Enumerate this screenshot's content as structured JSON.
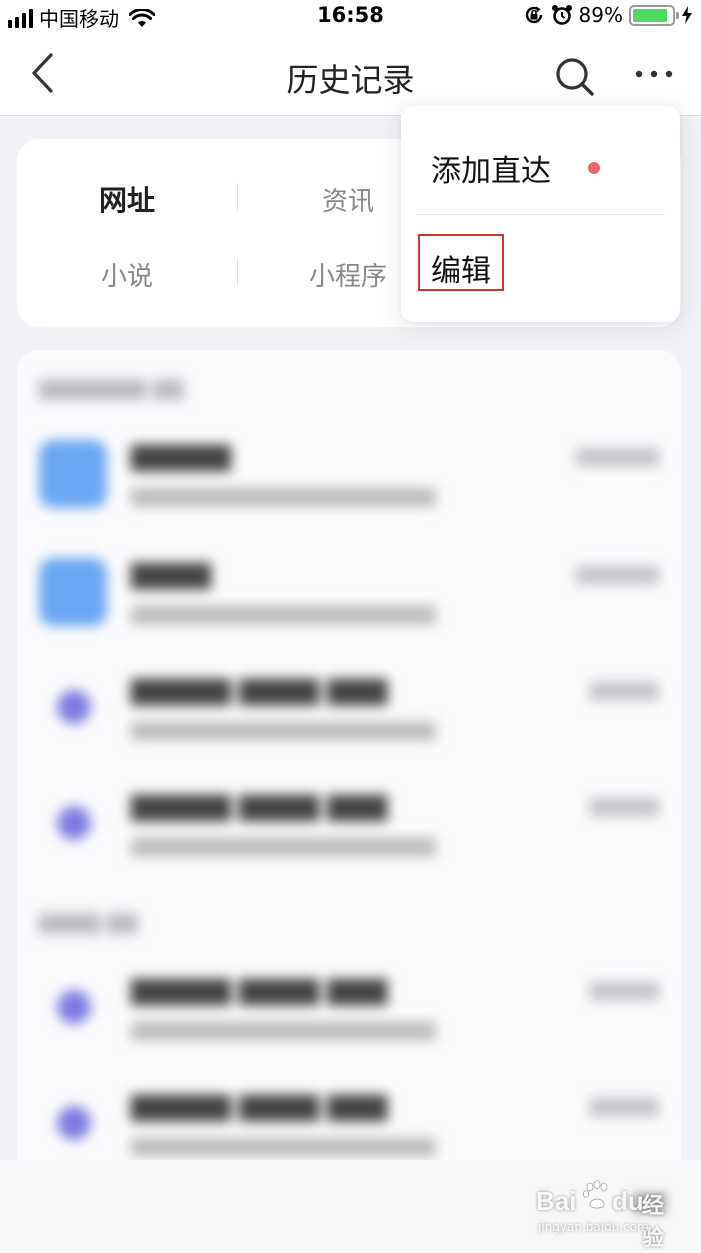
{
  "status_bar": {
    "carrier": "中国移动",
    "time": "16:58",
    "battery_percent": "89%",
    "battery_level": 0.89,
    "icons": [
      "signal-icon",
      "wifi-icon",
      "rotation-lock-icon",
      "alarm-icon",
      "battery-icon",
      "charging-icon"
    ]
  },
  "nav": {
    "title": "历史记录",
    "back_icon": "chevron-left-icon",
    "search_icon": "search-icon",
    "more_icon": "more-dots-icon"
  },
  "categories": {
    "items": [
      {
        "label": "网址",
        "active": true
      },
      {
        "label": "资讯",
        "active": false
      },
      {
        "label": "小说",
        "active": false
      },
      {
        "label": "小程序",
        "active": false
      }
    ]
  },
  "popup_menu": {
    "items": [
      {
        "label": "添加直达",
        "has_badge": true
      },
      {
        "label": "编辑",
        "highlighted": true
      }
    ],
    "badge_color": "#e86a6a",
    "highlight_color": "#d0342c"
  },
  "watermark": {
    "brand": "Bai",
    "brand2": "du",
    "product": "经验",
    "url": "jingyan.baidu.com"
  },
  "colors": {
    "accent_blue": "#6aa6f2",
    "accent_purple": "#7d7ae0",
    "page_bg": "#f1f1f6"
  }
}
